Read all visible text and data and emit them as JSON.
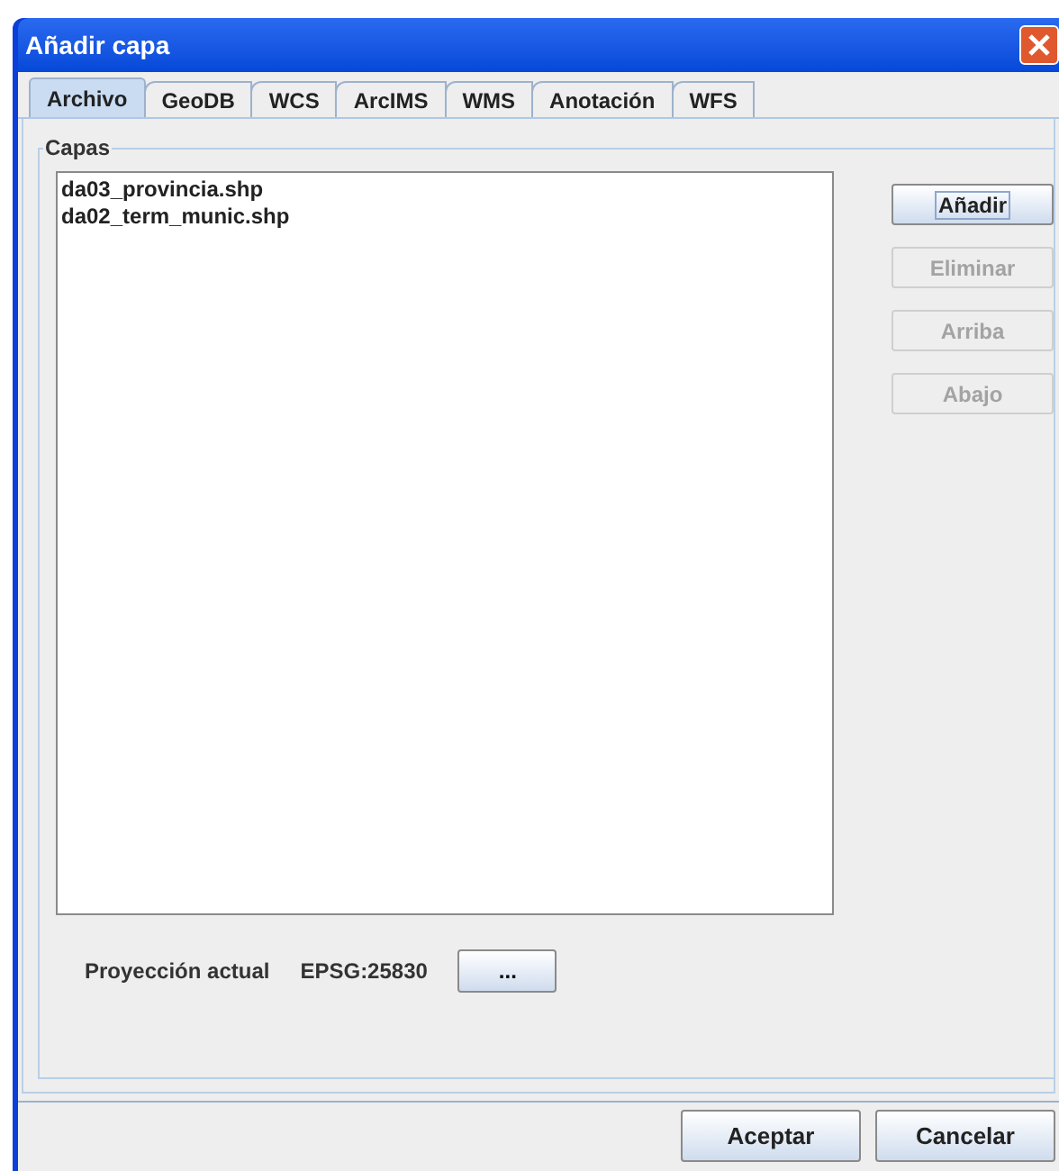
{
  "window": {
    "title": "Añadir capa"
  },
  "tabs": [
    {
      "label": "Archivo",
      "selected": true
    },
    {
      "label": "GeoDB",
      "selected": false
    },
    {
      "label": "WCS",
      "selected": false
    },
    {
      "label": "ArcIMS",
      "selected": false
    },
    {
      "label": "WMS",
      "selected": false
    },
    {
      "label": "Anotación",
      "selected": false
    },
    {
      "label": "WFS",
      "selected": false
    }
  ],
  "layers_group": {
    "title": "Capas",
    "items": [
      "da03_provincia.shp",
      "da02_term_munic.shp"
    ],
    "buttons": [
      {
        "label": "Añadir",
        "disabled": false,
        "focused": true
      },
      {
        "label": "Eliminar",
        "disabled": true,
        "focused": false
      },
      {
        "label": "Arriba",
        "disabled": true,
        "focused": false
      },
      {
        "label": "Abajo",
        "disabled": true,
        "focused": false
      }
    ]
  },
  "projection": {
    "label": "Proyección actual",
    "value": "EPSG:25830",
    "button": "..."
  },
  "footer_buttons": [
    "Aceptar",
    "Cancelar"
  ]
}
